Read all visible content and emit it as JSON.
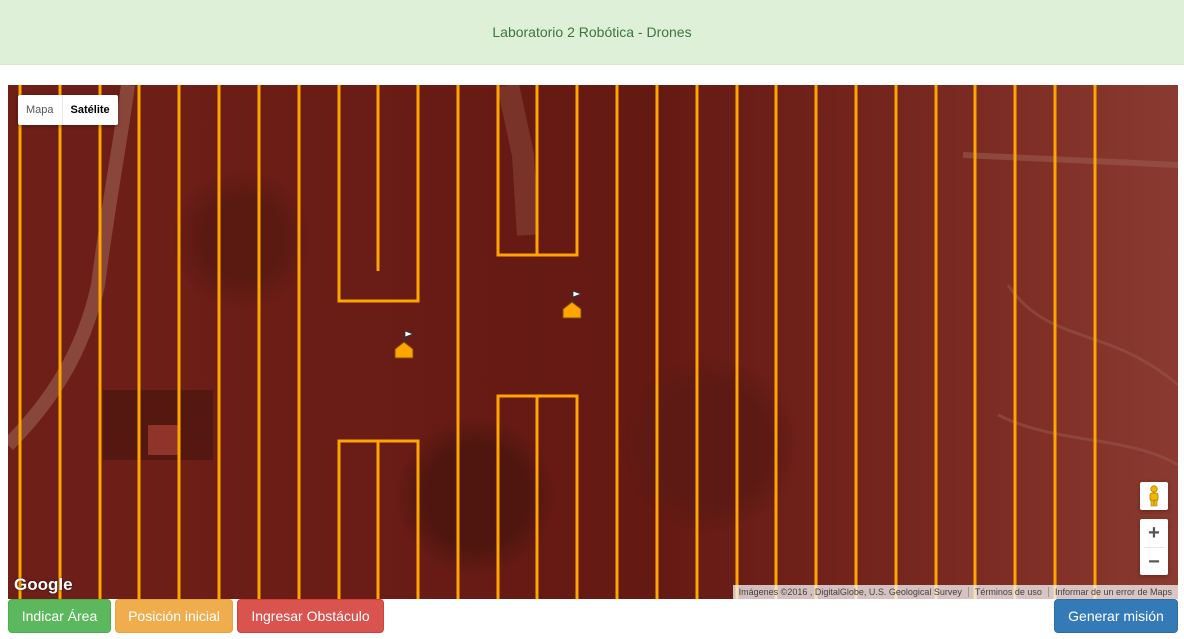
{
  "header": {
    "title": "Laboratorio 2 Robótica - Drones"
  },
  "map": {
    "type_control": {
      "map_label": "Mapa",
      "satellite_label": "Satélite",
      "selected": "Satélite"
    },
    "logo": "Google",
    "attribution": {
      "imagery": "Imágenes ©2016 , DigitalGlobe, U.S. Geological Survey",
      "terms": "Términos de uso",
      "report": "Informar de un error de Maps"
    },
    "zoom": {
      "in_label": "+",
      "out_label": "−"
    },
    "icons": {
      "pegman": "pegman-icon",
      "marker": "flag-marker-icon"
    },
    "colors": {
      "overlay": "#6e1f18",
      "flight_path": "#ffa500"
    }
  },
  "buttons": {
    "indicar_area": "Indicar Área",
    "posicion_inicial": "Posición inicial",
    "ingresar_obstaculo": "Ingresar Obstáculo",
    "generar_mision": "Generar misión"
  }
}
